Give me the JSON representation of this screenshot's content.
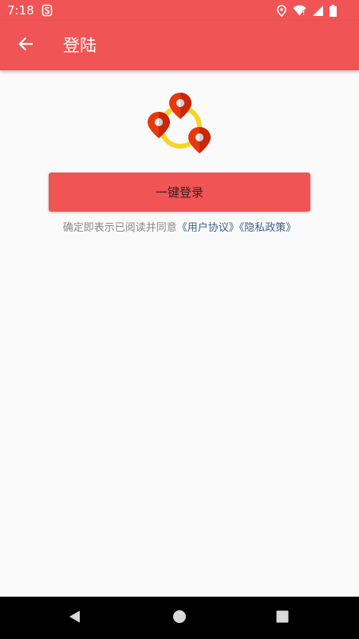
{
  "status_bar": {
    "time": "7:18"
  },
  "app_bar": {
    "title": "登陆",
    "back_icon": "arrow-back-icon"
  },
  "content": {
    "logo_icon": "location-pins-ring-logo",
    "login_button_label": "一键登录",
    "agreement": {
      "prefix": "确定即表示已阅读并同意",
      "user_agreement": "《用户协议》",
      "privacy_policy": "《隐私政策》"
    }
  },
  "colors": {
    "primary": "#f05454",
    "link": "#3d5f86",
    "hint_text": "#888888",
    "ring": "#f8d42a",
    "pin": "#e8380d"
  }
}
